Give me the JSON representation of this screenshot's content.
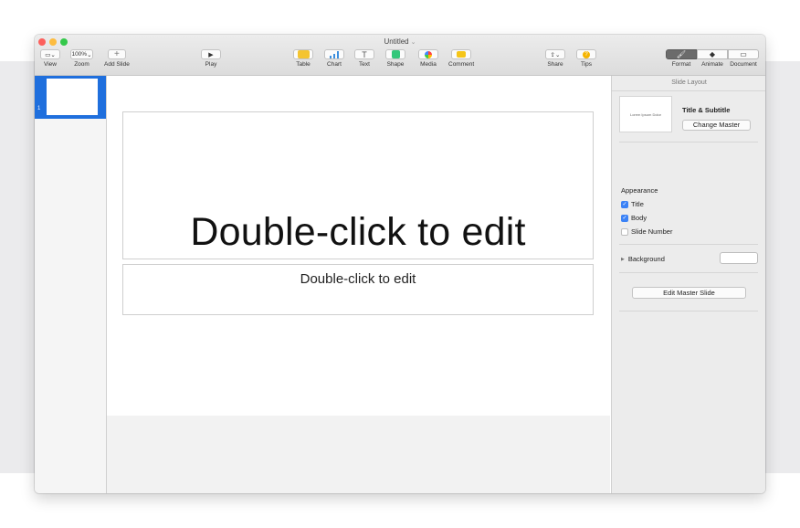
{
  "window": {
    "title": "Untitled",
    "title_chevron": "⌄"
  },
  "toolbar": {
    "view": {
      "icon": "sidebar-icon",
      "label": "View",
      "glyph": "▭⌄"
    },
    "zoom": {
      "value": "100%",
      "chevron": "⌄",
      "label": "Zoom"
    },
    "add_slide": {
      "icon": "plus-icon",
      "glyph": "+",
      "label": "Add Slide"
    },
    "play": {
      "icon": "play-icon",
      "glyph": "▶",
      "label": "Play"
    },
    "table": {
      "icon": "table-icon",
      "label": "Table",
      "color": "#f4c430"
    },
    "chart": {
      "icon": "chart-icon",
      "label": "Chart",
      "color": "#3b8ede"
    },
    "text": {
      "icon": "text-icon",
      "glyph": "T",
      "label": "Text"
    },
    "shape": {
      "icon": "shape-icon",
      "label": "Shape",
      "color": "#34c77b"
    },
    "media": {
      "icon": "media-icon",
      "label": "Media"
    },
    "comment": {
      "icon": "comment-icon",
      "label": "Comment",
      "color": "#f5c518"
    },
    "share": {
      "icon": "share-icon",
      "glyph": "⇪⌄",
      "label": "Share"
    },
    "tips": {
      "icon": "tips-icon",
      "glyph": "?",
      "label": "Tips",
      "color": "#f5b400"
    },
    "tabs": [
      {
        "label": "Format",
        "glyph": "🖌",
        "icon": "paintbrush-icon",
        "active": true
      },
      {
        "label": "Animate",
        "glyph": "◆",
        "icon": "diamond-icon",
        "active": false
      },
      {
        "label": "Document",
        "glyph": "▭",
        "icon": "document-icon",
        "active": false
      }
    ]
  },
  "navigator": {
    "slides": [
      {
        "number": "1",
        "selected": true
      }
    ]
  },
  "slide": {
    "title_placeholder": "Double-click to edit",
    "body_placeholder": "Double-click to edit"
  },
  "inspector": {
    "header": "Slide Layout",
    "layout_thumb_text": "Lorem Ipsum Dolor",
    "layout_name": "Title & Subtitle",
    "change_master_label": "Change Master",
    "appearance_title": "Appearance",
    "appearance_items": [
      {
        "label": "Title",
        "checked": true
      },
      {
        "label": "Body",
        "checked": true
      },
      {
        "label": "Slide Number",
        "checked": false
      }
    ],
    "background_label": "Background",
    "edit_master_label": "Edit Master Slide"
  },
  "colors": {
    "selection": "#1f6fdd",
    "checkbox_on": "#3b82f6",
    "traffic_red": "#fc605c",
    "traffic_yellow": "#fdbc40",
    "traffic_green": "#34c84a"
  }
}
